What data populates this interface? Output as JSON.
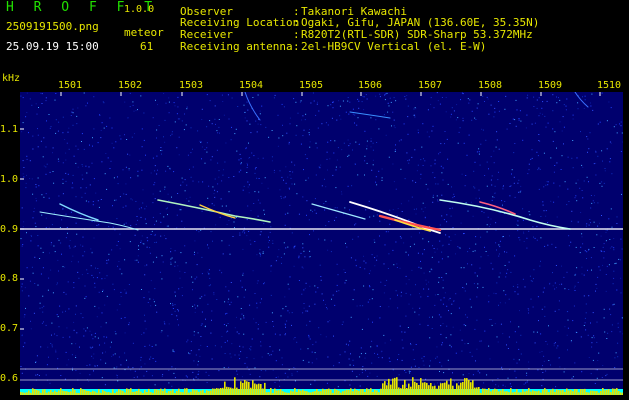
{
  "header": {
    "brand": "H R O F F T",
    "version": "1.0.0",
    "filename": "2509191500.png",
    "timestamp": "25.09.19 15:00",
    "meteor_label": "meteor",
    "meteor_count": "61",
    "info": [
      {
        "key": "Observer",
        "sep": ":",
        "value": "Takanori Kawachi"
      },
      {
        "key": "Receiving Location",
        "sep": ":",
        "value": "Ogaki, Gifu, JAPAN (136.60E, 35.35N)"
      },
      {
        "key": "Receiver",
        "sep": ":",
        "value": "R820T2(RTL-SDR) SDR-Sharp 53.372MHz"
      },
      {
        "key": "Receiving antenna",
        "sep": ":",
        "value": "2el-HB9CV Vertical (el. E-W)"
      }
    ]
  },
  "spectrogram": {
    "y_unit": "kHz",
    "x_ticks": [
      "1501",
      "1502",
      "1503",
      "1504",
      "1505",
      "1506",
      "1507",
      "1508",
      "1509",
      "1510"
    ],
    "y_ticks": [
      "1.1",
      "1.0",
      "0.9",
      "0.8",
      "0.7",
      "0.6"
    ],
    "colors": {
      "background": "#000088",
      "carrier": "#ffffff",
      "meteor": "#ff4040",
      "axis_text": "#e6e600",
      "power_bar": "#e6e600",
      "baseline": "#00ffff"
    }
  }
}
